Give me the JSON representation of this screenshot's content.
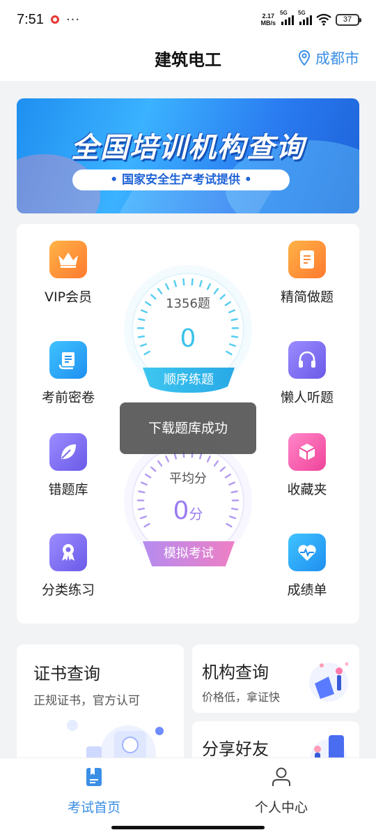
{
  "status_bar": {
    "time": "7:51",
    "dots": "···",
    "net_speed_value": "2.17",
    "net_speed_unit": "MB/s",
    "sig1_label": "5G",
    "sig2_label": "5G",
    "battery": "37"
  },
  "header": {
    "title": "建筑电工",
    "location": "成都市",
    "accent_color": "#3a8ee6"
  },
  "banner": {
    "title": "全国培训机构查询",
    "subtitle": "• 国家安全生产考试提供 •"
  },
  "grid": {
    "vip": "VIP会员",
    "simplified": "精简做题",
    "exam_secret": "考前密卷",
    "lazy_listen": "懒人听题",
    "wrong_bank": "错题库",
    "favorites": "收藏夹",
    "category_practice": "分类练习",
    "score_sheet": "成绩单"
  },
  "gauge_practice": {
    "count_label": "1356题",
    "value": "0",
    "button": "顺序练题"
  },
  "gauge_exam": {
    "label": "平均分",
    "value": "0",
    "unit": "分",
    "button": "模拟考试"
  },
  "toast": "下载题库成功",
  "cards": {
    "certificate_title": "证书查询",
    "certificate_sub": "正规证书，官方认可",
    "institution_title": "机构查询",
    "institution_sub": "价格低，拿证快",
    "share_title": "分享好友"
  },
  "bottom_nav": {
    "home": "考试首页",
    "profile": "个人中心",
    "active_color": "#3a8ee6"
  }
}
